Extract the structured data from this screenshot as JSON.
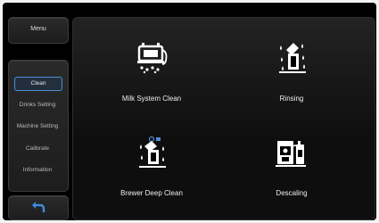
{
  "menu": {
    "label": "Menu"
  },
  "nav": {
    "items": [
      {
        "label": "Clean",
        "active": true
      },
      {
        "label": "Drinks Setting",
        "active": false
      },
      {
        "label": "Machine Setting",
        "active": false
      },
      {
        "label": "Calibrate",
        "active": false
      },
      {
        "label": "Information",
        "active": false
      }
    ]
  },
  "back": {
    "icon": "back-arrow-icon"
  },
  "tiles": [
    {
      "label": "Milk System Clean",
      "icon": "milk-system-clean-icon"
    },
    {
      "label": "Rinsing",
      "icon": "rinsing-icon"
    },
    {
      "label": "Brewer Deep Clean",
      "icon": "brewer-deep-clean-icon"
    },
    {
      "label": "Descaling",
      "icon": "descaling-icon"
    }
  ],
  "colors": {
    "accent": "#4a8fd6",
    "background": "#000000",
    "text": "#eeeeee"
  }
}
